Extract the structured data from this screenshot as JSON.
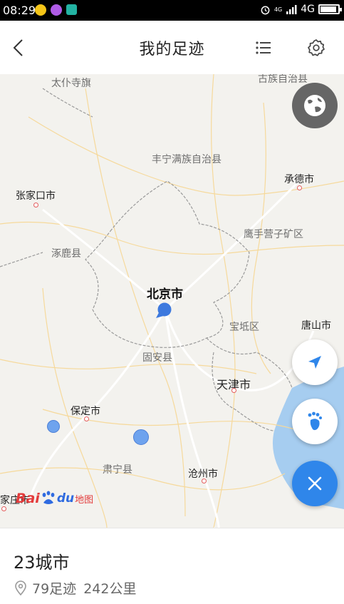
{
  "status_bar": {
    "time": "08:29",
    "network": "4G",
    "signal_mini": "4G"
  },
  "header": {
    "title": "我的足迹"
  },
  "map": {
    "labels": {
      "taipusi": "太仆寺旗",
      "guzu": "古族自治县",
      "fengning": "丰宁满族自治县",
      "zhangjiakou": "张家口市",
      "chengde": "承德市",
      "zhuolu": "涿鹿县",
      "yingshou": "鹰手营子矿区",
      "beijing": "北京市",
      "baodi": "宝坻区",
      "tangshan": "唐山市",
      "guan": "固安县",
      "tianjin": "天津市",
      "baoding": "保定市",
      "suning": "肃宁县",
      "cangzhou": "沧州市",
      "jiazhuang": "家庄市"
    },
    "logo": {
      "bai": "Bai",
      "du": "du",
      "map_text": "地图"
    }
  },
  "summary": {
    "cities": "23城市",
    "footprints": "79足迹",
    "distance": "242公里"
  },
  "colors": {
    "accent": "#2f86ea",
    "marker": "#5b8ee6",
    "city_dot": "#e35d5d"
  }
}
